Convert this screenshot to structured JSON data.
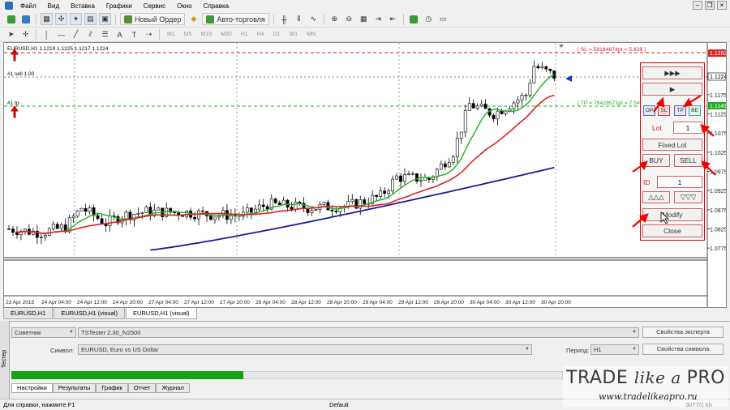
{
  "menu": {
    "items": [
      "Файл",
      "Вид",
      "Вставка",
      "Графики",
      "Сервис",
      "Окно",
      "Справка"
    ]
  },
  "toolbar": {
    "new_order": "Новый Ордер",
    "autotrade": "Авто-торговля",
    "timeframes": [
      "M1",
      "M5",
      "M15",
      "M30",
      "H1",
      "H4",
      "D1",
      "W1",
      "MN"
    ]
  },
  "chart": {
    "header": "EURUSD,H1  1.1219 1.1225 1.1217 1.1224",
    "sell_line_label": "#1 sell 1.00",
    "tp_line_label": "#1 tp",
    "sl_label": "[ SL = 58184874pt = 5.82$ ]",
    "tp_label": "[ TP = 75428571pt = 7.54$ ] SL = 1.13 ]",
    "price_axis": [
      "1.1282",
      "1.1224",
      "1.1175",
      "1.1149",
      "1.1125",
      "1.1075",
      "1.1025",
      "1.0975",
      "1.0925",
      "1.0875",
      "1.0825",
      "1.0775"
    ],
    "time_axis": [
      "23 Apr 2015",
      "24 Apr 04:00",
      "24 Apr 12:00",
      "24 Apr 20:00",
      "27 Apr 04:00",
      "27 Apr 12:00",
      "27 Apr 20:00",
      "28 Apr 04:00",
      "28 Apr 12:00",
      "28 Apr 20:00",
      "29 Apr 04:00",
      "29 Apr 12:00",
      "29 Apr 20:00",
      "30 Apr 04:00",
      "30 Apr 12:00",
      "30 Apr 20:00"
    ],
    "colors": {
      "bull": "#ffffff",
      "bear": "#000000",
      "ma_fast": "#22b022",
      "ma_mid": "#dd2222",
      "ma_slow": "#1a1a9a",
      "sl_line": "#dd2222",
      "tp_line": "#22aa22"
    }
  },
  "chart_tabs": [
    "EURUSD,H1",
    "EURUSD,H1 (visual)",
    "EURUSD,H1 (visual)"
  ],
  "panel": {
    "fast_fwd": "▶▶▶",
    "play": "▶",
    "op": "OP",
    "sl": "SL",
    "tp": "TP",
    "be": "BE",
    "lot_label": "Lot",
    "lot_value": "1",
    "fixed_lot": "Fixed Lot",
    "buy": "BUY",
    "sell": "SELL",
    "id_label": "ID",
    "id_value": "1",
    "up": "△△△",
    "down": "▽▽▽",
    "modify": "Modify",
    "close": "Close"
  },
  "tester": {
    "side_label": "Тестер",
    "expert_label": "Советник",
    "expert_value": "TSTester 2.30_fv2500",
    "expert_btn": "Свойства эксперта",
    "symbol_label": "Символ:",
    "symbol_value": "EURUSD, Euro vs US Dollar",
    "period_label": "Период:",
    "period_value": "H1",
    "symbol_btn": "Свойства символа",
    "progress": 0.42,
    "tabs": [
      "Настройки",
      "Результаты",
      "График",
      "Отчет",
      "Журнал"
    ]
  },
  "status": {
    "help": "Для справки, нажмите F1",
    "profile": "Default",
    "traffic": "3077/1 kb"
  },
  "watermark": {
    "brand_a": "TRADE ",
    "brand_b": "like a ",
    "brand_c": "PRO",
    "url": "www.tradelikeapro.ru"
  }
}
